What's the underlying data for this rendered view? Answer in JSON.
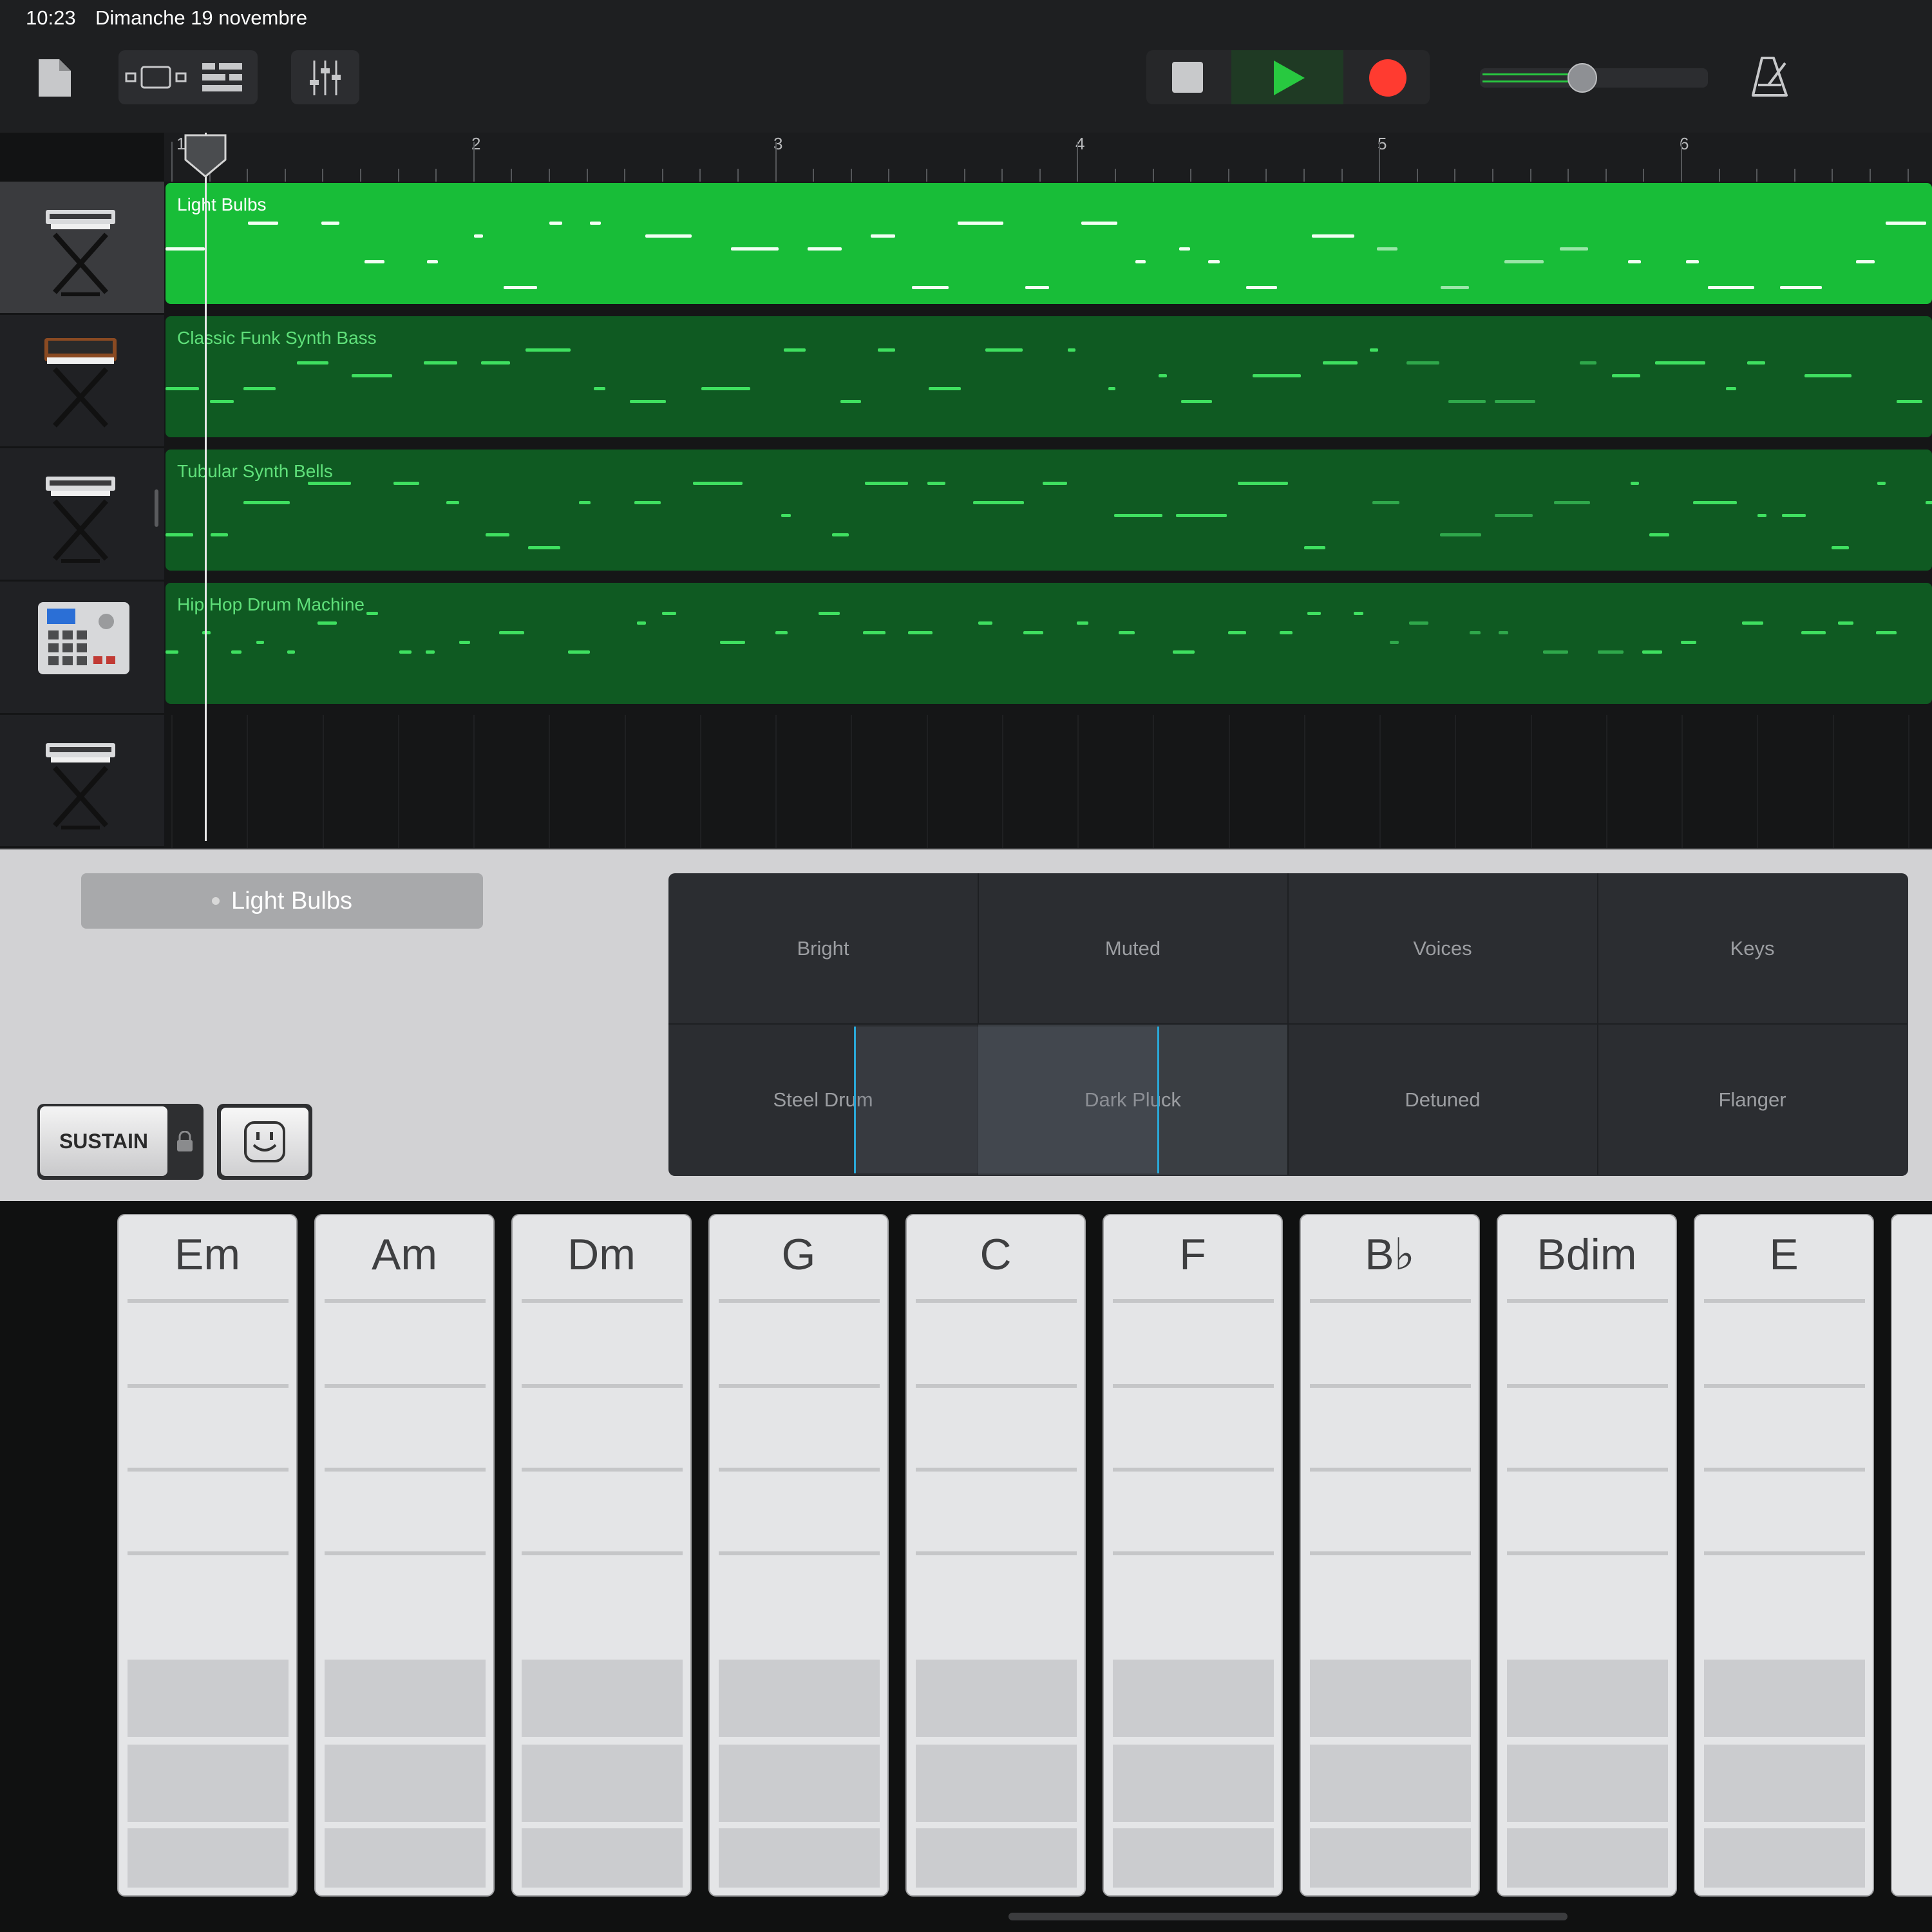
{
  "status": {
    "time": "10:23",
    "date": "Dimanche 19 novembre"
  },
  "toolbar": {
    "buttons": [
      "document-icon",
      "view-toggle-icon",
      "tracks-view-icon",
      "mixer-icon",
      "stop-icon",
      "play-icon",
      "record-icon",
      "metronome-icon"
    ],
    "volume_level": 0.45,
    "colors": {
      "play": "#28c940",
      "record": "#ff3b30"
    }
  },
  "ruler": {
    "bars": [
      "1",
      "2",
      "3",
      "4",
      "5",
      "6"
    ]
  },
  "tracks": [
    {
      "name": "Light Bulbs",
      "instrument": "keyboard-stand-icon",
      "selected": true
    },
    {
      "name": "Classic Funk Synth Bass",
      "instrument": "vintage-synth-icon",
      "selected": false
    },
    {
      "name": "Tubular Synth Bells",
      "instrument": "keyboard-stand-icon",
      "selected": false
    },
    {
      "name": "Hip Hop Drum Machine",
      "instrument": "drum-machine-icon",
      "selected": false
    },
    {
      "name": "",
      "instrument": "keyboard-stand-icon",
      "selected": false
    }
  ],
  "panel": {
    "instrument_name": "Light Bulbs",
    "sustain_label": "SUSTAIN",
    "autoplay_icon": "smiley-face-icon",
    "sounds": [
      "Bright",
      "Muted",
      "Voices",
      "Keys",
      "Steel Drum",
      "Dark Pluck",
      "Detuned",
      "Flanger"
    ],
    "sound_selected": "Dark Pluck"
  },
  "chords": [
    "Em",
    "Am",
    "Dm",
    "G",
    "C",
    "F",
    "B♭",
    "Bdim",
    "E"
  ]
}
